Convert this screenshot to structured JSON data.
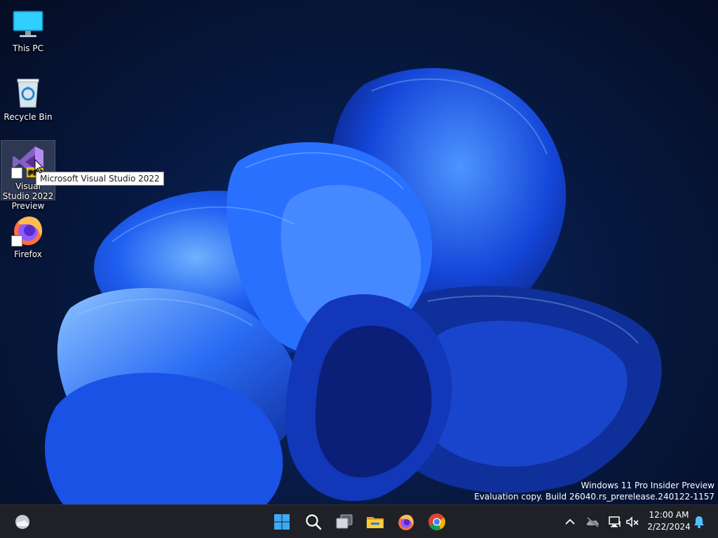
{
  "desktop": {
    "icons": [
      {
        "label": "This PC",
        "icon": "monitor-icon"
      },
      {
        "label": "Recycle Bin",
        "icon": "recycle-bin-icon"
      },
      {
        "label": "Visual Studio 2022 Preview",
        "icon": "visual-studio-icon",
        "badge": "PRE"
      },
      {
        "label": "Firefox",
        "icon": "firefox-icon"
      }
    ],
    "tooltip": "Microsoft Visual Studio 2022"
  },
  "watermark": {
    "line1": "Windows 11 Pro Insider Preview",
    "line2": "Evaluation copy. Build 26040.rs_prerelease.240122-1157"
  },
  "taskbar": {
    "left": [
      "weather-icon"
    ],
    "center": [
      "windows-start-icon",
      "search-icon",
      "task-view-icon",
      "file-explorer-icon",
      "firefox-icon",
      "chrome-icon"
    ],
    "tray": [
      "chevron-up-icon",
      "onedrive-icon",
      "network-icon",
      "volume-muted-icon",
      "notification-bell-icon"
    ],
    "clock": {
      "time": "12:00 AM",
      "date": "2/22/2024"
    }
  },
  "colors": {
    "taskbar_bg": "#1f2127",
    "accent": "#1e6bff",
    "tooltip_bg": "#ffffff"
  }
}
